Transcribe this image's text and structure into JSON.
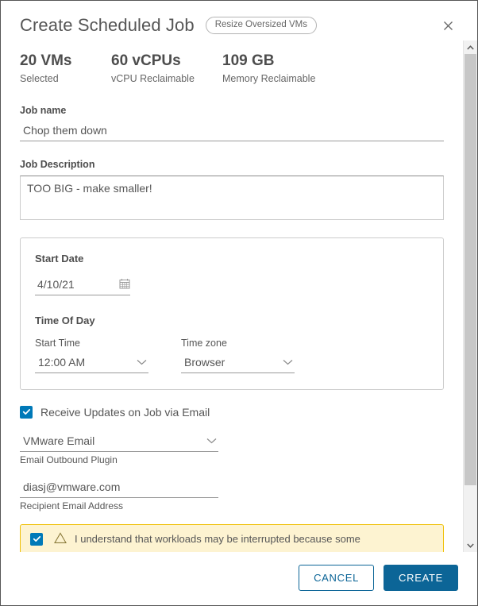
{
  "dialog": {
    "title": "Create Scheduled Job",
    "badge": "Resize Oversized VMs",
    "close_icon": "close-icon"
  },
  "stats": [
    {
      "value": "20 VMs",
      "label": "Selected"
    },
    {
      "value": "60 vCPUs",
      "label": "vCPU Reclaimable"
    },
    {
      "value": "109 GB",
      "label": "Memory Reclaimable"
    }
  ],
  "form": {
    "job_name_label": "Job name",
    "job_name_value": "Chop them down",
    "job_description_label": "Job Description",
    "job_description_value": "TOO BIG - make smaller!",
    "schedule": {
      "start_date_label": "Start Date",
      "start_date_value": "4/10/21",
      "calendar_icon": "calendar-icon",
      "time_of_day_label": "Time Of Day",
      "start_time_label": "Start Time",
      "start_time_value": "12:00 AM",
      "timezone_label": "Time zone",
      "timezone_value": "Browser"
    },
    "email": {
      "receive_updates_label": "Receive Updates on Job via Email",
      "receive_updates_checked": true,
      "plugin_value": "VMware Email",
      "plugin_helper": "Email Outbound Plugin",
      "recipient_value": "diasj@vmware.com",
      "recipient_helper": "Recipient Email Address"
    },
    "warning": {
      "checked": true,
      "icon": "warning-triangle-icon",
      "text": "I understand that workloads may be interrupted because some"
    }
  },
  "scrollbar": {
    "up_icon": "chevron-up-icon",
    "down_icon": "chevron-down-icon"
  },
  "footer": {
    "cancel_label": "CANCEL",
    "create_label": "CREATE"
  },
  "colors": {
    "accent": "#0c6597",
    "checkbox": "#0079b8",
    "warning_bg": "#fdf3d1",
    "warning_border": "#efc006"
  }
}
